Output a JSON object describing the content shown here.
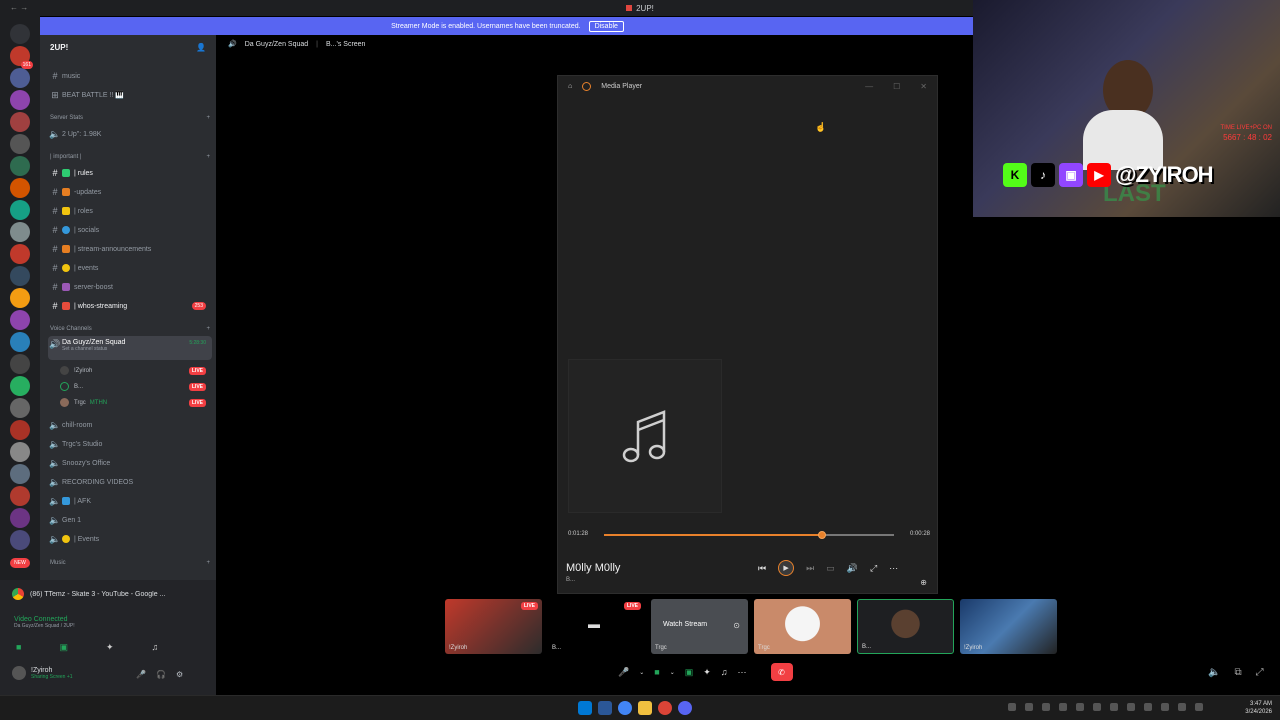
{
  "window": {
    "title": "2UP!"
  },
  "banner": {
    "text": "Streamer Mode is enabled. Usernames have been truncated.",
    "button": "Disable"
  },
  "server": {
    "name": "2UP!"
  },
  "channels": {
    "music": "music",
    "beat_battle": "BEAT BATTLE !! 🎹",
    "cat_stats": "Server Stats",
    "stats_members": "2 Up\": 1.98K",
    "cat_important": "| important |",
    "rules": "| rules",
    "updates": "-updates",
    "roles": "| roles",
    "socials": "| socials",
    "stream_ann": "| stream-announcements",
    "events": "| events",
    "server_boost": "server-boost",
    "whos_streaming": "| whos-streaming",
    "whos_count": "253",
    "cat_voice": "Voice Channels",
    "voice_squad": "Da Guyz/Zen Squad",
    "voice_timer": "5:28:30",
    "voice_status": "Set a channel status",
    "chill": "chill-room",
    "trgc_studio": "Trgc's Studio",
    "snoozy": "Snoozy's Office",
    "recording": "RECORDING VIDEOS",
    "afk": "| AFK",
    "gen1": "Gen 1",
    "events2": "| Events",
    "cat_music": "Music"
  },
  "voice_users": [
    {
      "name": "!Zyiroh",
      "live": "LIVE"
    },
    {
      "name": "B...",
      "live": "LIVE"
    },
    {
      "name": "Trgc",
      "tag": "MTHN",
      "live": "LIVE"
    }
  ],
  "panel": {
    "activity": "(86) TTemz - Skate 3 - YouTube - Google ...",
    "video": "Video Connected",
    "video_sub": "Da Guyz/Zen Squad / 2UP!",
    "user": "!Zyiroh",
    "user_sub": "Sharing Screen +1"
  },
  "stage": {
    "channel": "Da Guyz/Zen Squad",
    "screen": "B...'s Screen"
  },
  "media_player": {
    "title": "Media Player",
    "elapsed": "0:01:28",
    "remaining": "0:00:28",
    "progress": 0.75,
    "track": "M0lly M0lly",
    "subtitle": "B..."
  },
  "overlay": {
    "handle": "@ZYIROH",
    "time_text": "TIME LIVE+PC ON",
    "time_value": "5667 : 48 : 02",
    "last": "LAST"
  },
  "tiles": [
    {
      "name": "!Zyiroh",
      "live": "LIVE"
    },
    {
      "name": "B...",
      "live": "LIVE"
    },
    {
      "name": "Trgc",
      "label": "Watch Stream"
    },
    {
      "name": "Trgc"
    },
    {
      "name": "B..."
    },
    {
      "name": "!Zyiroh"
    }
  ],
  "clock": {
    "time": "3:47 AM",
    "date": "3/24/2026"
  },
  "colors": {
    "accent": "#5865f2",
    "live": "#f23f43",
    "seek": "#e8812b"
  }
}
